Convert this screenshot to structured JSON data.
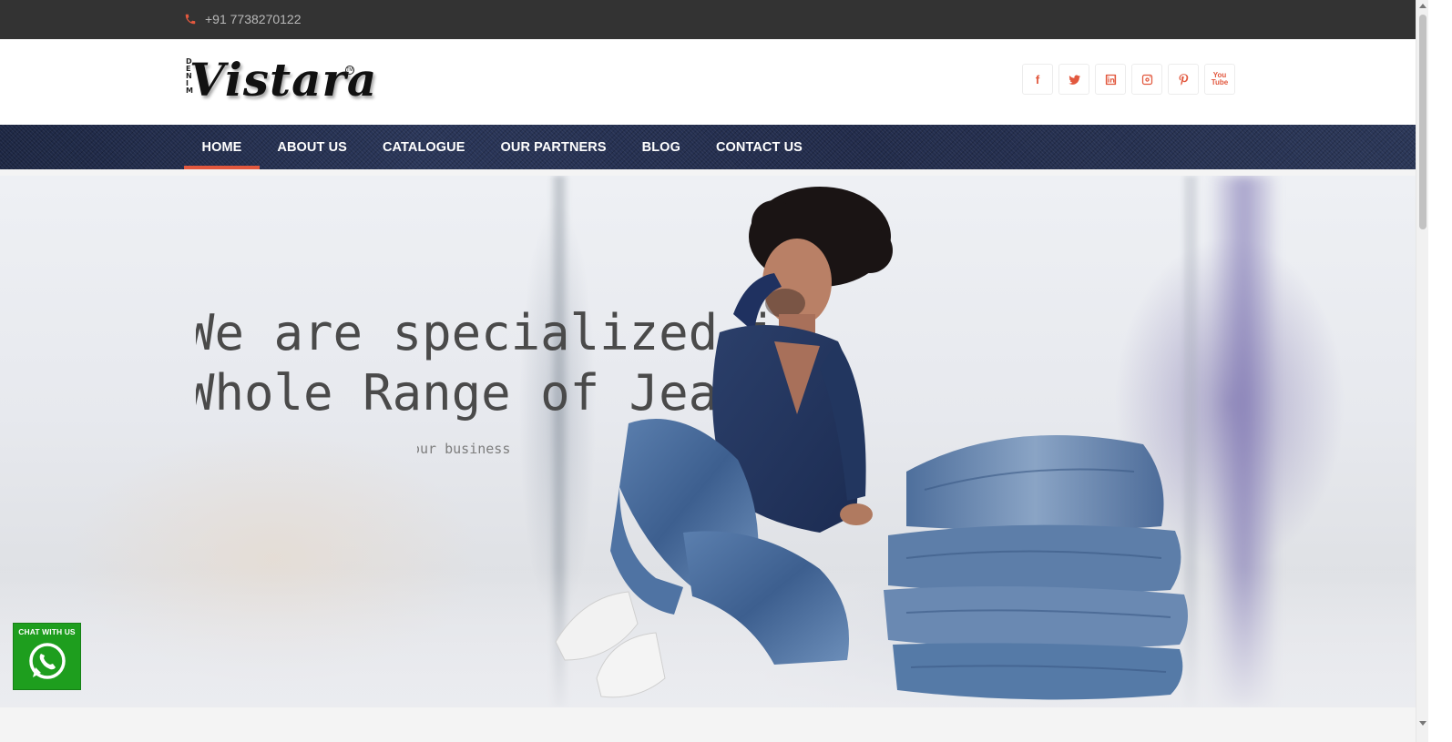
{
  "topbar": {
    "phone_icon": "phone-icon",
    "phone": "+91 7738270122",
    "accent": "#e2583e"
  },
  "header": {
    "logo_text": "Vistara",
    "logo_side_letters": "DENIM",
    "logo_mark": "TM",
    "socials": [
      {
        "icon": "facebook-icon",
        "glyph": "f"
      },
      {
        "icon": "twitter-icon",
        "glyph": ""
      },
      {
        "icon": "linkedin-icon",
        "glyph": ""
      },
      {
        "icon": "instagram-icon",
        "glyph": ""
      },
      {
        "icon": "pinterest-icon",
        "glyph": ""
      },
      {
        "icon": "youtube-icon",
        "glyph": "You Tube"
      }
    ]
  },
  "nav": {
    "items": [
      {
        "label": "HOME",
        "active": true
      },
      {
        "label": "ABOUT US"
      },
      {
        "label": "CATALOGUE"
      },
      {
        "label": "OUR PARTNERS"
      },
      {
        "label": "BLOG"
      },
      {
        "label": "CONTACT US"
      }
    ]
  },
  "hero": {
    "title_line1": "We are specialized in",
    "title_line2": "Whole Range of Jeans",
    "subtitle": "our business"
  },
  "whatsapp": {
    "label": "CHAT WITH US",
    "icon": "whatsapp-icon",
    "color": "#1e9e1e"
  }
}
